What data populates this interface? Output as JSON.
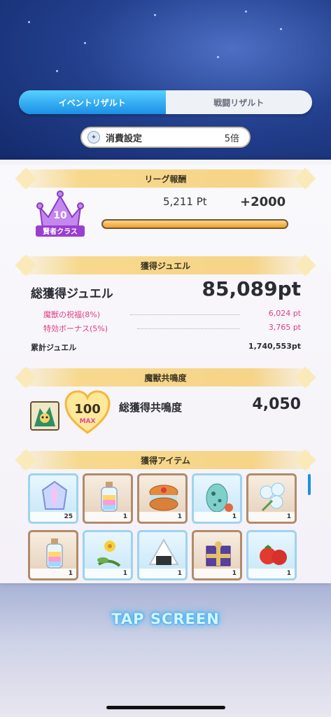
{
  "tabs": [
    {
      "label": "イベントリザルト",
      "active": true
    },
    {
      "label": "戦闘リザルト",
      "active": false
    }
  ],
  "consume": {
    "label": "消費設定",
    "value": "5倍"
  },
  "league": {
    "title": "リーグ報酬",
    "rank_number": "10",
    "rank_class": "賢者クラス",
    "points": "5,211 Pt",
    "bonus": "+2000",
    "progress_fraction": 1.0
  },
  "jewel": {
    "title": "獲得ジュエル",
    "total_label": "総獲得ジュエル",
    "total_value": "85,089pt",
    "subs": [
      {
        "label": "魔獣の祝福(8%)",
        "value": "6,024 pt"
      },
      {
        "label": "特効ボーナス(5%)",
        "value": "3,765 pt"
      }
    ],
    "cumulative_label": "累計ジュエル",
    "cumulative_value": "1,740,553pt"
  },
  "resonance": {
    "title": "魔獣共鳴度",
    "level": "100",
    "max_label": "MAX",
    "label": "総獲得共鳴度",
    "value": "4,050"
  },
  "items": {
    "title": "獲得アイテム",
    "list": [
      {
        "icon": "crystal-icon",
        "count": "25",
        "frame": "blue"
      },
      {
        "icon": "rainbow-bottle-icon",
        "count": "1",
        "frame": "brown"
      },
      {
        "icon": "cookie-sandwich-icon",
        "count": "1",
        "frame": "brown"
      },
      {
        "icon": "spotted-egg-icon",
        "count": "1",
        "frame": "blue"
      },
      {
        "icon": "white-flower-bouquet-icon",
        "count": "1",
        "frame": "brown"
      },
      {
        "icon": "rainbow-bottle-icon",
        "count": "1",
        "frame": "brown"
      },
      {
        "icon": "yellow-flower-icon",
        "count": "1",
        "frame": "blue"
      },
      {
        "icon": "rice-ball-icon",
        "count": "1",
        "frame": "blue"
      },
      {
        "icon": "gift-box-icon",
        "count": "1",
        "frame": "brown"
      },
      {
        "icon": "tomato-icon",
        "count": "1",
        "frame": "blue"
      }
    ]
  },
  "tap_screen": "TAP SCREEN",
  "colors": {
    "tab_active": "#1b8fe6",
    "accent_pink": "#e23b87",
    "ribbon": "#f6d488",
    "crown": "#a855d8"
  }
}
